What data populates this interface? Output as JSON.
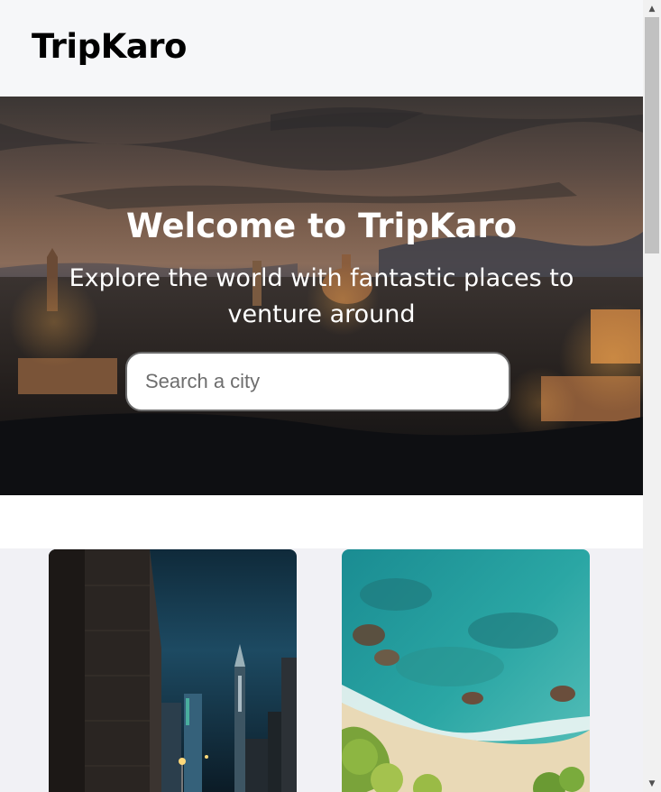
{
  "header": {
    "brand": "TripKaro"
  },
  "hero": {
    "title": "Welcome to TripKaro",
    "subtitle": "Explore the world with fantastic places to venture around",
    "search": {
      "placeholder": "Search a city",
      "value": ""
    }
  },
  "cards": [
    {
      "image": "city-night-street"
    },
    {
      "image": "beach-aerial"
    }
  ],
  "scrollbar": {
    "up_glyph": "▲",
    "down_glyph": "▼"
  }
}
